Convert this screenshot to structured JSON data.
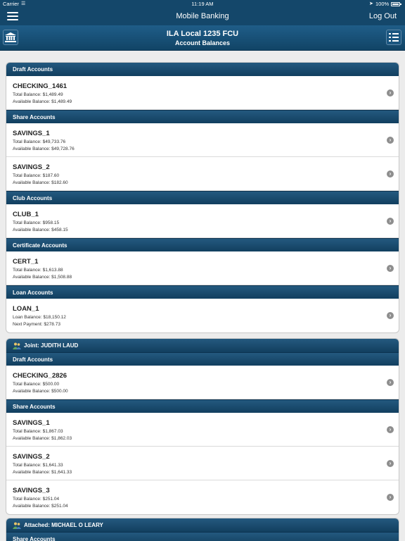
{
  "status_bar": {
    "carrier": "Carrier",
    "time": "11:19 AM",
    "battery": "100%"
  },
  "nav": {
    "title": "Mobile Banking",
    "logout": "Log Out"
  },
  "header": {
    "title": "ILA Local 1235 FCU",
    "subtitle": "Account Balances"
  },
  "primary": {
    "sections": [
      {
        "title": "Draft Accounts",
        "accounts": [
          {
            "name": "CHECKING_1461",
            "line1": "Total Balance: $1,489.49",
            "line2": "Available Balance: $1,489.49"
          }
        ]
      },
      {
        "title": "Share Accounts",
        "accounts": [
          {
            "name": "SAVINGS_1",
            "line1": "Total Balance: $49,733.76",
            "line2": "Available Balance: $49,728.76"
          },
          {
            "name": "SAVINGS_2",
            "line1": "Total Balance: $187.60",
            "line2": "Available Balance: $182.60"
          }
        ]
      },
      {
        "title": "Club Accounts",
        "accounts": [
          {
            "name": "CLUB_1",
            "line1": "Total Balance: $958.15",
            "line2": "Available Balance: $458.15"
          }
        ]
      },
      {
        "title": "Certificate Accounts",
        "accounts": [
          {
            "name": "CERT_1",
            "line1": "Total Balance: $1,613.88",
            "line2": "Available Balance: $1,508.88"
          }
        ]
      },
      {
        "title": "Loan Accounts",
        "accounts": [
          {
            "name": "LOAN_1",
            "line1": "Loan Balance: $18,150.12",
            "line2": "Next Payment: $278.73"
          }
        ]
      }
    ]
  },
  "joint": {
    "owner": "Joint: JUDITH LAUD",
    "sections": [
      {
        "title": "Draft Accounts",
        "accounts": [
          {
            "name": "CHECKING_2826",
            "line1": "Total Balance: $500.00",
            "line2": "Available Balance: $500.00"
          }
        ]
      },
      {
        "title": "Share Accounts",
        "accounts": [
          {
            "name": "SAVINGS_1",
            "line1": "Total Balance: $1,867.03",
            "line2": "Available Balance: $1,862.03"
          },
          {
            "name": "SAVINGS_2",
            "line1": "Total Balance: $1,641.33",
            "line2": "Available Balance: $1,641.33"
          },
          {
            "name": "SAVINGS_3",
            "line1": "Total Balance: $251.04",
            "line2": "Available Balance: $251.04"
          }
        ]
      }
    ]
  },
  "attached": {
    "owner": "Attached: MICHAEL O LEARY",
    "sections": [
      {
        "title": "Share Accounts",
        "accounts": []
      }
    ]
  }
}
